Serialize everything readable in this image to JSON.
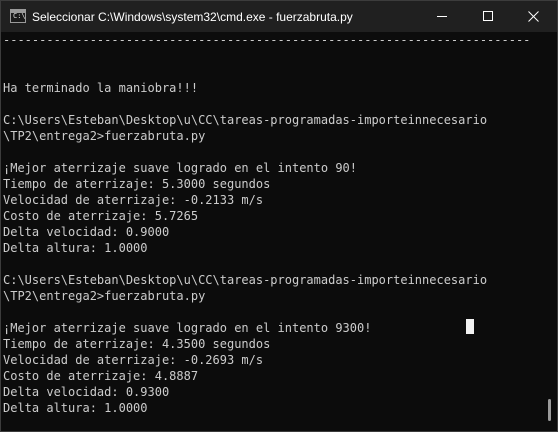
{
  "window": {
    "title": "Seleccionar C:\\Windows\\system32\\cmd.exe - fuerzabruta.py",
    "icon": "cmd-icon",
    "icon_prompt": "C:\\"
  },
  "controls": {
    "minimize_icon": "minimize-icon",
    "maximize_icon": "maximize-icon",
    "close_icon": "close-icon"
  },
  "console": {
    "lines": [
      "-------------------------------------------------------------------------",
      "",
      "",
      "Ha terminado la maniobra!!!",
      "",
      "C:\\Users\\Esteban\\Desktop\\u\\CC\\tareas-programadas-importeinnecesario",
      "\\TP2\\entrega2>fuerzabruta.py",
      "",
      "¡Mejor aterrizaje suave logrado en el intento 90!",
      "Tiempo de aterrizaje: 5.3000 segundos",
      "Velocidad de aterrizaje: -0.2133 m/s",
      "Costo de aterrizaje: 5.7265",
      "Delta velocidad: 0.9000",
      "Delta altura: 1.0000",
      "",
      "C:\\Users\\Esteban\\Desktop\\u\\CC\\tareas-programadas-importeinnecesario",
      "\\TP2\\entrega2>fuerzabruta.py",
      "",
      "¡Mejor aterrizaje suave logrado en el intento 9300!",
      "Tiempo de aterrizaje: 4.3500 segundos",
      "Velocidad de aterrizaje: -0.2693 m/s",
      "Costo de aterrizaje: 4.8887",
      "Delta velocidad: 0.9300",
      "Delta altura: 1.0000"
    ]
  },
  "colors": {
    "background": "#0c0c0c",
    "text": "#cccccc",
    "titlebar": "#202020"
  }
}
